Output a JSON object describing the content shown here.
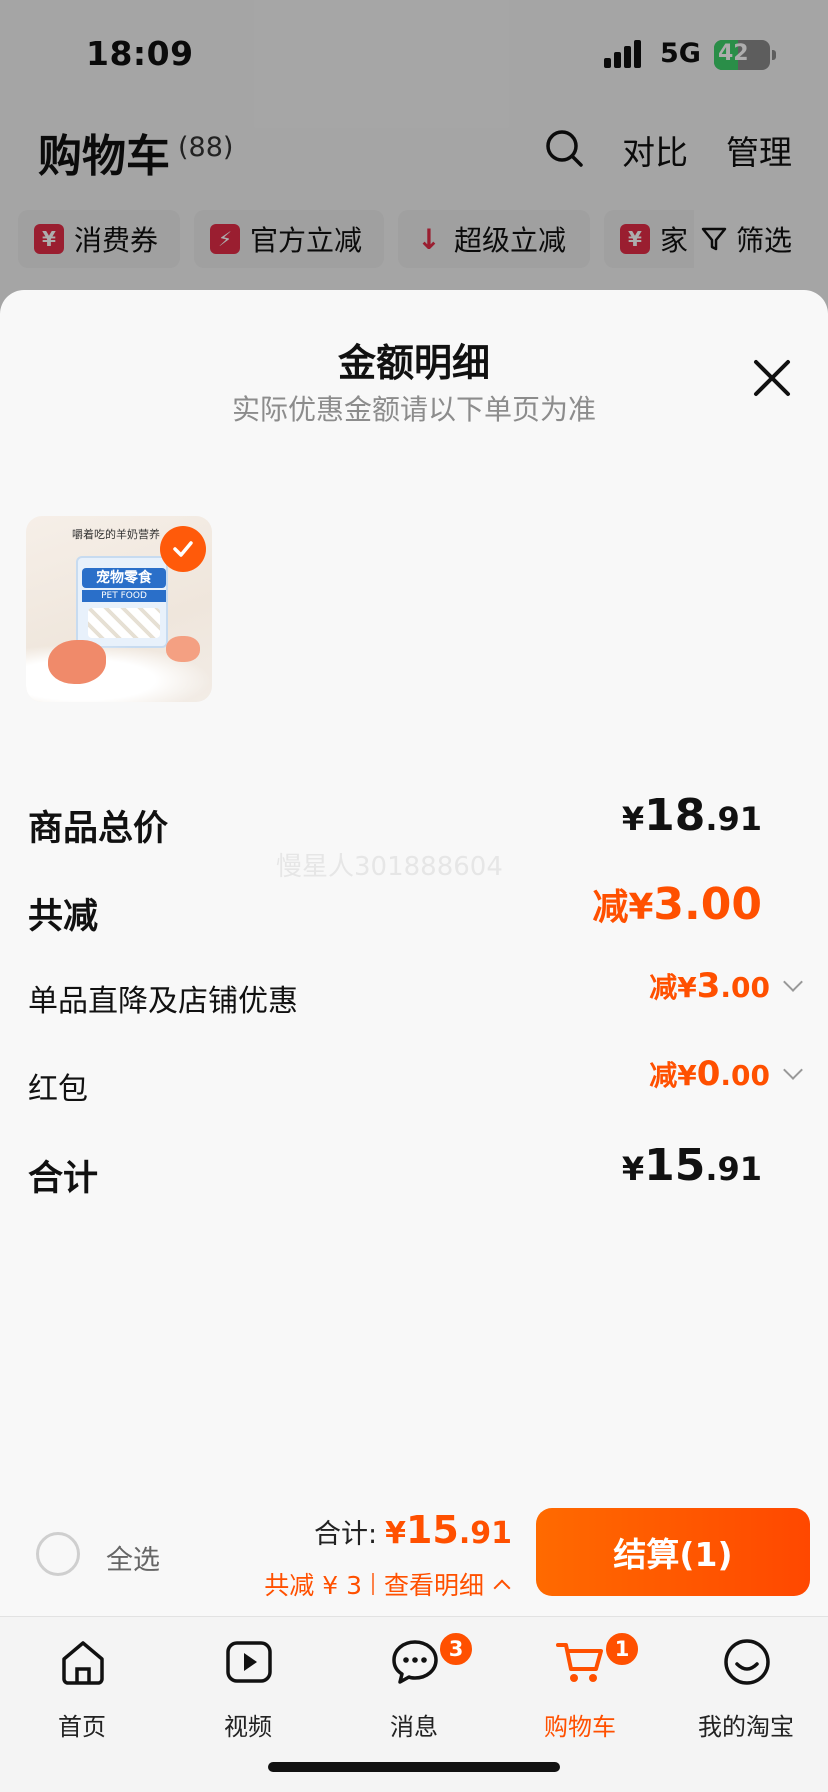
{
  "status_bar": {
    "time": "18:09",
    "network": "5G",
    "battery": "42"
  },
  "header": {
    "title": "购物车",
    "count": "(88)",
    "compare": "对比",
    "manage": "管理"
  },
  "filter_chips": [
    {
      "icon": "¥",
      "label": "消费券"
    },
    {
      "icon": "⚡",
      "label": "官方立减"
    },
    {
      "icon": "↓",
      "label": "超级立减"
    },
    {
      "icon": "¥",
      "label": "家"
    }
  ],
  "filter_label": "筛选",
  "sheet": {
    "title": "金额明细",
    "subtitle": "实际优惠金额请以下单页为准",
    "product": {
      "tagline": "嚼着吃的羊奶营养",
      "pack_name": "宠物零食",
      "pack_sub": "PET FOOD"
    },
    "watermark": "慢星人301888604",
    "rows": {
      "subtotal": {
        "label": "商品总价",
        "yen": "¥",
        "int": "18",
        "dec": ".91"
      },
      "total_discount": {
        "label": "共减",
        "prefix": "减",
        "yen": "¥",
        "int": "3",
        "dec": ".00"
      },
      "item_discount": {
        "label": "单品直降及店铺优惠",
        "prefix": "减",
        "yen": "¥",
        "int": "3",
        "dec": ".00"
      },
      "red_packet": {
        "label": "红包",
        "prefix": "减",
        "yen": "¥",
        "int": "0",
        "dec": ".00"
      },
      "grand_total": {
        "label": "合计",
        "yen": "¥",
        "int": "15",
        "dec": ".91"
      }
    }
  },
  "checkout": {
    "select_all": "全选",
    "total_label": "合计:",
    "total_yen": "¥",
    "total_int": "15",
    "total_dec": ".91",
    "discount_text": "共减 ¥ 3",
    "detail_link": "查看明细",
    "button": "结算(1)"
  },
  "tabs": [
    {
      "label": "首页",
      "icon": "home-icon",
      "badge": ""
    },
    {
      "label": "视频",
      "icon": "video-icon",
      "badge": ""
    },
    {
      "label": "消息",
      "icon": "message-icon",
      "badge": "3"
    },
    {
      "label": "购物车",
      "icon": "cart-icon",
      "badge": "1"
    },
    {
      "label": "我的淘宝",
      "icon": "profile-icon",
      "badge": ""
    }
  ],
  "colors": {
    "accent": "#ff5000",
    "chip_badge": "#e32d48"
  }
}
